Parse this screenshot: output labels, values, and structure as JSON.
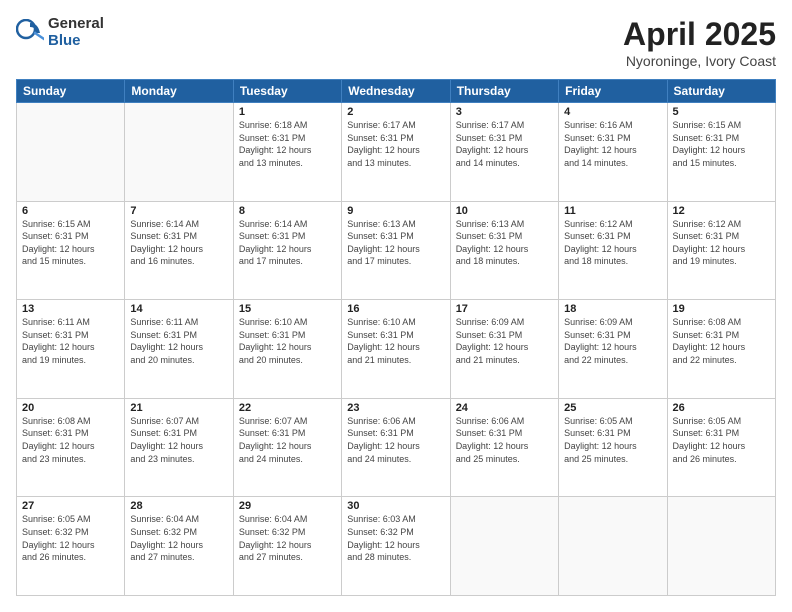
{
  "header": {
    "logo_general": "General",
    "logo_blue": "Blue",
    "title": "April 2025",
    "location": "Nyoroninge, Ivory Coast"
  },
  "days_of_week": [
    "Sunday",
    "Monday",
    "Tuesday",
    "Wednesday",
    "Thursday",
    "Friday",
    "Saturday"
  ],
  "weeks": [
    [
      {
        "day": "",
        "info": ""
      },
      {
        "day": "",
        "info": ""
      },
      {
        "day": "1",
        "info": "Sunrise: 6:18 AM\nSunset: 6:31 PM\nDaylight: 12 hours\nand 13 minutes."
      },
      {
        "day": "2",
        "info": "Sunrise: 6:17 AM\nSunset: 6:31 PM\nDaylight: 12 hours\nand 13 minutes."
      },
      {
        "day": "3",
        "info": "Sunrise: 6:17 AM\nSunset: 6:31 PM\nDaylight: 12 hours\nand 14 minutes."
      },
      {
        "day": "4",
        "info": "Sunrise: 6:16 AM\nSunset: 6:31 PM\nDaylight: 12 hours\nand 14 minutes."
      },
      {
        "day": "5",
        "info": "Sunrise: 6:15 AM\nSunset: 6:31 PM\nDaylight: 12 hours\nand 15 minutes."
      }
    ],
    [
      {
        "day": "6",
        "info": "Sunrise: 6:15 AM\nSunset: 6:31 PM\nDaylight: 12 hours\nand 15 minutes."
      },
      {
        "day": "7",
        "info": "Sunrise: 6:14 AM\nSunset: 6:31 PM\nDaylight: 12 hours\nand 16 minutes."
      },
      {
        "day": "8",
        "info": "Sunrise: 6:14 AM\nSunset: 6:31 PM\nDaylight: 12 hours\nand 17 minutes."
      },
      {
        "day": "9",
        "info": "Sunrise: 6:13 AM\nSunset: 6:31 PM\nDaylight: 12 hours\nand 17 minutes."
      },
      {
        "day": "10",
        "info": "Sunrise: 6:13 AM\nSunset: 6:31 PM\nDaylight: 12 hours\nand 18 minutes."
      },
      {
        "day": "11",
        "info": "Sunrise: 6:12 AM\nSunset: 6:31 PM\nDaylight: 12 hours\nand 18 minutes."
      },
      {
        "day": "12",
        "info": "Sunrise: 6:12 AM\nSunset: 6:31 PM\nDaylight: 12 hours\nand 19 minutes."
      }
    ],
    [
      {
        "day": "13",
        "info": "Sunrise: 6:11 AM\nSunset: 6:31 PM\nDaylight: 12 hours\nand 19 minutes."
      },
      {
        "day": "14",
        "info": "Sunrise: 6:11 AM\nSunset: 6:31 PM\nDaylight: 12 hours\nand 20 minutes."
      },
      {
        "day": "15",
        "info": "Sunrise: 6:10 AM\nSunset: 6:31 PM\nDaylight: 12 hours\nand 20 minutes."
      },
      {
        "day": "16",
        "info": "Sunrise: 6:10 AM\nSunset: 6:31 PM\nDaylight: 12 hours\nand 21 minutes."
      },
      {
        "day": "17",
        "info": "Sunrise: 6:09 AM\nSunset: 6:31 PM\nDaylight: 12 hours\nand 21 minutes."
      },
      {
        "day": "18",
        "info": "Sunrise: 6:09 AM\nSunset: 6:31 PM\nDaylight: 12 hours\nand 22 minutes."
      },
      {
        "day": "19",
        "info": "Sunrise: 6:08 AM\nSunset: 6:31 PM\nDaylight: 12 hours\nand 22 minutes."
      }
    ],
    [
      {
        "day": "20",
        "info": "Sunrise: 6:08 AM\nSunset: 6:31 PM\nDaylight: 12 hours\nand 23 minutes."
      },
      {
        "day": "21",
        "info": "Sunrise: 6:07 AM\nSunset: 6:31 PM\nDaylight: 12 hours\nand 23 minutes."
      },
      {
        "day": "22",
        "info": "Sunrise: 6:07 AM\nSunset: 6:31 PM\nDaylight: 12 hours\nand 24 minutes."
      },
      {
        "day": "23",
        "info": "Sunrise: 6:06 AM\nSunset: 6:31 PM\nDaylight: 12 hours\nand 24 minutes."
      },
      {
        "day": "24",
        "info": "Sunrise: 6:06 AM\nSunset: 6:31 PM\nDaylight: 12 hours\nand 25 minutes."
      },
      {
        "day": "25",
        "info": "Sunrise: 6:05 AM\nSunset: 6:31 PM\nDaylight: 12 hours\nand 25 minutes."
      },
      {
        "day": "26",
        "info": "Sunrise: 6:05 AM\nSunset: 6:31 PM\nDaylight: 12 hours\nand 26 minutes."
      }
    ],
    [
      {
        "day": "27",
        "info": "Sunrise: 6:05 AM\nSunset: 6:32 PM\nDaylight: 12 hours\nand 26 minutes."
      },
      {
        "day": "28",
        "info": "Sunrise: 6:04 AM\nSunset: 6:32 PM\nDaylight: 12 hours\nand 27 minutes."
      },
      {
        "day": "29",
        "info": "Sunrise: 6:04 AM\nSunset: 6:32 PM\nDaylight: 12 hours\nand 27 minutes."
      },
      {
        "day": "30",
        "info": "Sunrise: 6:03 AM\nSunset: 6:32 PM\nDaylight: 12 hours\nand 28 minutes."
      },
      {
        "day": "",
        "info": ""
      },
      {
        "day": "",
        "info": ""
      },
      {
        "day": "",
        "info": ""
      }
    ]
  ]
}
